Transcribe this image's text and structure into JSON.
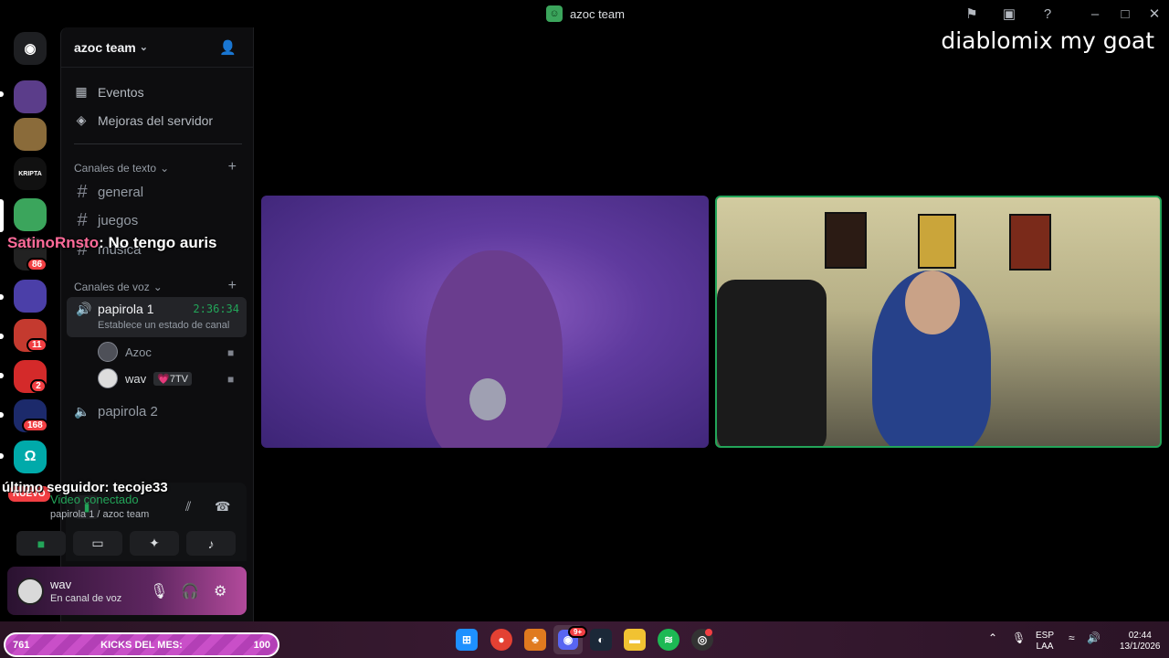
{
  "window": {
    "title": "azoc team"
  },
  "overlay": {
    "caption": "diablomix my goat",
    "chat_user": "SatinoRnsto",
    "chat_message": ": No tengo auris",
    "follower_text": "último seguidor: tecoje33"
  },
  "rail": {
    "badges": [
      "86",
      "11",
      "2",
      "168"
    ],
    "new_label": "NUEVO",
    "kripta_label": "KRIPTA"
  },
  "server": {
    "name": "azoc team",
    "nav": [
      {
        "label": "Eventos",
        "icon": "calendar-icon"
      },
      {
        "label": "Mejoras del servidor",
        "icon": "boost-icon"
      }
    ],
    "text_category": "Canales de texto",
    "text_channels": [
      "general",
      "juegos",
      "música"
    ],
    "voice_category": "Canales de voz",
    "voice_channel_active": {
      "name": "papirola 1",
      "time": "2:36:34",
      "status": "Establece un estado de canal"
    },
    "members": [
      {
        "name": "Azoc",
        "tag": ""
      },
      {
        "name": "wav",
        "tag": "💗7TV"
      }
    ],
    "voice_channel_2": "papirola 2"
  },
  "voice_connection": {
    "title": "Video conectado",
    "subtitle": "papirola 1 / azoc team"
  },
  "user_panel": {
    "name": "wav",
    "status": "En canal de voz"
  },
  "taskbar": {
    "kicks_left": "761",
    "kicks_label": "KICKS DEL MES:",
    "kicks_right": "100",
    "discord_badge": "9+",
    "lang_top": "ESP",
    "lang_bottom": "LAA",
    "time": "02:44",
    "date": "13/1/2026"
  },
  "colors": {
    "accent_green": "#23a559",
    "badge_red": "#f23f43",
    "kicks_pink": "#c94fc8"
  }
}
